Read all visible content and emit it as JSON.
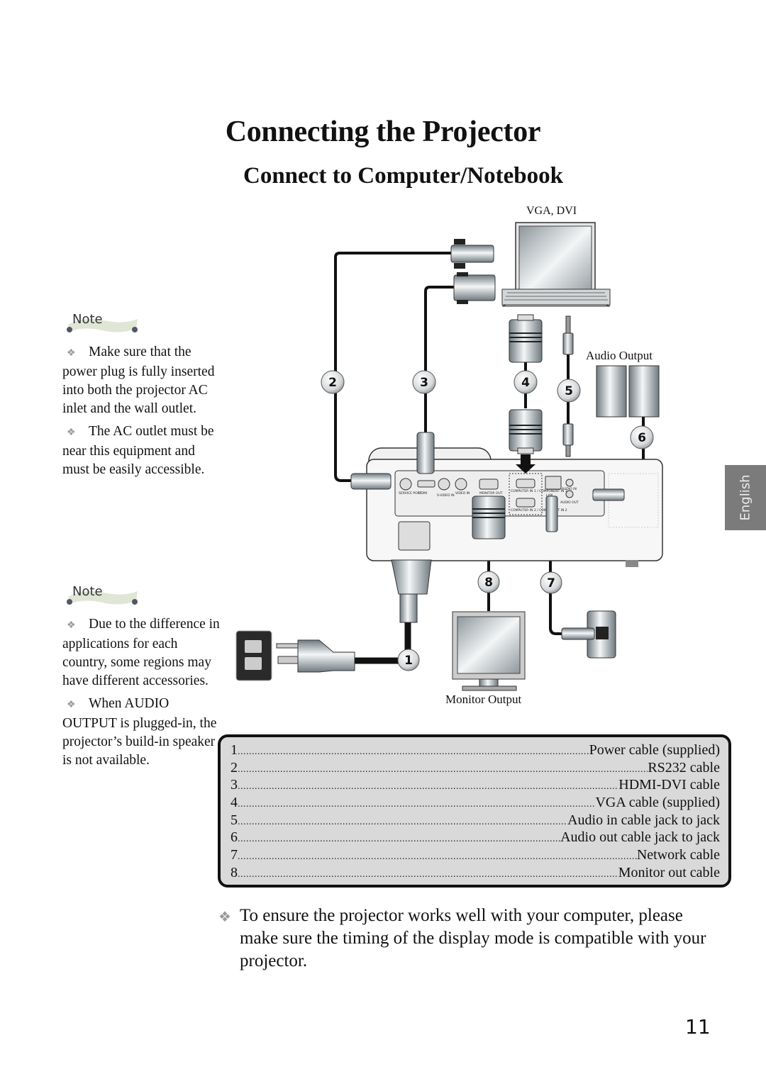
{
  "page": {
    "title": "Connecting the Projector",
    "section_title": "Connect to Computer/Notebook",
    "page_number": "11",
    "language_tab": "English"
  },
  "notes": [
    {
      "banner": "Note",
      "items": [
        "Make sure that the power plug is fully inserted into both the projector AC inlet and the wall outlet.",
        "The AC outlet must be near this equipment and must be easily accessible."
      ]
    },
    {
      "banner": "Note",
      "items": [
        "Due to the difference in applications for each country, some regions may have different accessories.",
        "When AUDIO OUTPUT is plugged-in, the projector’s build-in speaker is not available."
      ]
    }
  ],
  "diagram": {
    "labels": {
      "laptop": "VGA, DVI",
      "speakers": "Audio Output",
      "monitor": "Monitor Output"
    },
    "callouts": [
      "1",
      "2",
      "3",
      "4",
      "5",
      "6",
      "7",
      "8"
    ],
    "panel_ports": [
      "SERVICE PORT",
      "HDMI",
      "S-VIDEO IN",
      "VIDEO IN",
      "MONITOR OUT",
      "COMPUTER IN 1 / COMPONENT IN 1",
      "COMPUTER IN 2 / COMPONENT IN 2",
      "LAN",
      "AUDIO IN",
      "AUDIO OUT"
    ]
  },
  "legend": [
    {
      "num": "1",
      "label": "Power cable (supplied)"
    },
    {
      "num": "2",
      "label": "RS232 cable"
    },
    {
      "num": "3",
      "label": "HDMI-DVI cable"
    },
    {
      "num": "4",
      "label": "VGA cable (supplied)"
    },
    {
      "num": "5",
      "label": "Audio in cable jack to jack"
    },
    {
      "num": "6",
      "label": "Audio out cable jack to jack"
    },
    {
      "num": "7",
      "label": "Network cable"
    },
    {
      "num": "8",
      "label": "Monitor out cable"
    }
  ],
  "tip": "To ensure the projector works well with your computer, please make sure the timing of the display mode is compatible with your projector."
}
